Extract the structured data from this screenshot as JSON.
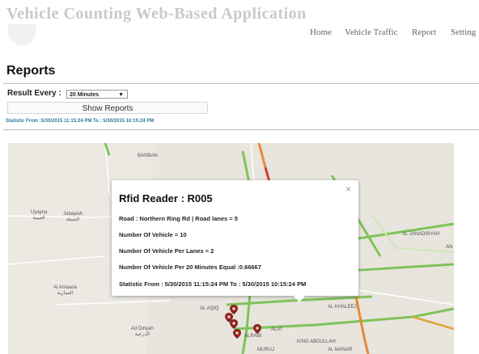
{
  "app": {
    "title": "Vehicle Counting Web-Based Application"
  },
  "nav": {
    "items": [
      "Home",
      "Vehicle Traffic",
      "Report",
      "Setting"
    ]
  },
  "page": {
    "title": "Reports"
  },
  "controls": {
    "result_label": "Result Every :",
    "result_value": "20 Minutes",
    "show_button": "Show Reports"
  },
  "statistic_line": "Statistic From :5/30/2015 11:15:24 PM To : 5/30/2015 10:15:24 PM",
  "map": {
    "labels": {
      "banban": "BANBAN",
      "uyayna": "Uyayna\nالعيينة",
      "jubaylah": "Jubaylah\nالجبيلة",
      "al_amaaria": "Al Amaaria\nالعمارية",
      "ad_diriyah": "Ad Diriyah\nالدرعية",
      "al_janadriyah": "AL JANADRIYAH",
      "an": "AN",
      "al_khaleej": "AL KHALEEJ",
      "al_aqiq": "AL AQIQ",
      "alat": "ALAT",
      "alrabi": "ALRABI",
      "murug": "MURUJ",
      "king_abdullah": "KING ABDULLAH",
      "al_manar": "AL MANAR"
    },
    "marker_color": "#8b2323"
  },
  "popup": {
    "close": "×",
    "title": "Rfid Reader : R005",
    "lines": [
      "Road : Northern Ring Rd | Road lanes = 5",
      "Number Of Vehicle = 10",
      "Number Of Vehicle Per Lanes = 2",
      "Number Of Vehicle Per 20 Minutes Equal :0.66667",
      "Statistic From : 5/30/2015 11:15:24 PM To : 5/30/2015 10:15:24 PM"
    ]
  }
}
